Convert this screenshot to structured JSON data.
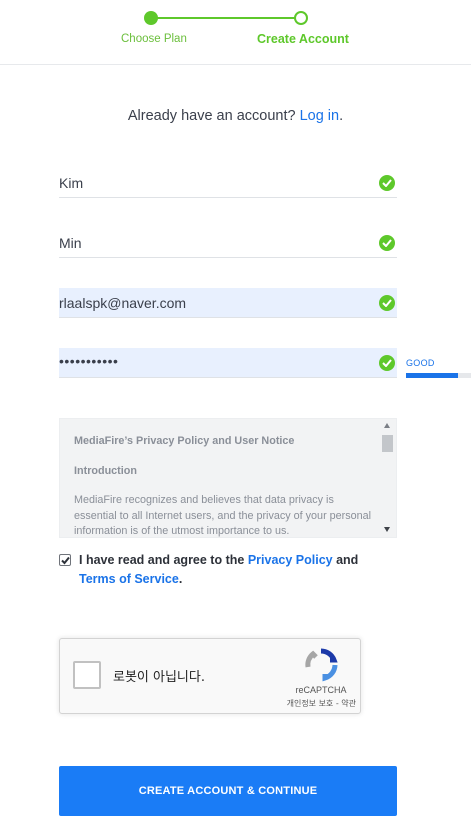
{
  "stepper": {
    "steps": [
      {
        "label": "Choose Plan",
        "state": "done"
      },
      {
        "label": "Create Account",
        "state": "current"
      }
    ]
  },
  "login_prompt": {
    "text": "Already have an account?",
    "link": "Log in",
    "suffix": "."
  },
  "form": {
    "first_name": "Kim",
    "last_name": "Min",
    "email": "rlaalspk@naver.com",
    "password_masked": "•••••••••••",
    "password_strength": {
      "label": "GOOD",
      "level": 0.8
    }
  },
  "policy": {
    "title": "MediaFire’s Privacy Policy and User Notice",
    "heading": "Introduction",
    "body": "MediaFire recognizes and believes that data privacy is essential to all Internet users, and the privacy of your personal information is of the utmost importance to us."
  },
  "agreement": {
    "checked": true,
    "prefix": "I have read and agree to the",
    "privacy_link": "Privacy Policy",
    "and": "and",
    "terms_link": "Terms of Service",
    "suffix": "."
  },
  "recaptcha": {
    "label": "로봇이 아닙니다.",
    "brand": "reCAPTCHA",
    "links": "개인정보 보호 - 약관"
  },
  "submit_label": "CREATE ACCOUNT & CONTINUE",
  "colors": {
    "accent_green": "#5ec82b",
    "link_blue": "#1a73e8",
    "button_blue": "#1a7cf6"
  }
}
